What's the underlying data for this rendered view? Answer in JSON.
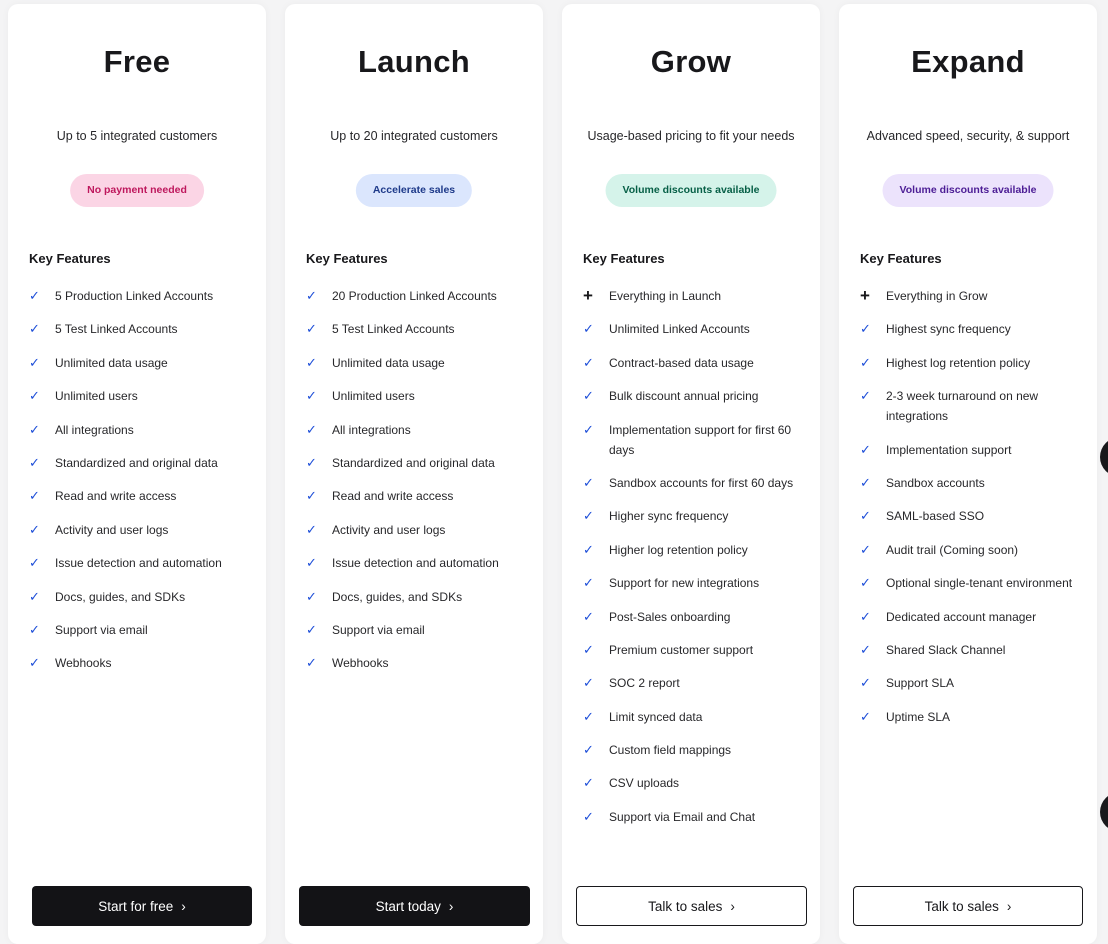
{
  "plans": [
    {
      "title": "Free",
      "subtitle": "Up to 5 integrated customers",
      "badge": "No payment needed",
      "badge_bg": "#fbd5e5",
      "badge_color": "#be185d",
      "key_features": "Key Features",
      "button": "Start for free",
      "button_style": "dark",
      "features": [
        {
          "icon": "check",
          "text": "5 Production Linked Accounts"
        },
        {
          "icon": "check",
          "text": "5 Test Linked Accounts"
        },
        {
          "icon": "check",
          "text": "Unlimited data usage"
        },
        {
          "icon": "check",
          "text": "Unlimited users"
        },
        {
          "icon": "check",
          "text": "All integrations"
        },
        {
          "icon": "check",
          "text": "Standardized and original data"
        },
        {
          "icon": "check",
          "text": "Read and write access"
        },
        {
          "icon": "check",
          "text": "Activity and user logs"
        },
        {
          "icon": "check",
          "text": "Issue detection and automation"
        },
        {
          "icon": "check",
          "text": "Docs, guides, and SDKs"
        },
        {
          "icon": "check",
          "text": "Support via email"
        },
        {
          "icon": "check",
          "text": "Webhooks"
        }
      ]
    },
    {
      "title": "Launch",
      "subtitle": "Up to 20 integrated customers",
      "badge": "Accelerate sales",
      "badge_bg": "#dbe6fd",
      "badge_color": "#1e3a8a",
      "key_features": "Key Features",
      "button": "Start today",
      "button_style": "dark",
      "features": [
        {
          "icon": "check",
          "text": "20 Production Linked Accounts"
        },
        {
          "icon": "check",
          "text": "5 Test Linked Accounts"
        },
        {
          "icon": "check",
          "text": "Unlimited data usage"
        },
        {
          "icon": "check",
          "text": "Unlimited users"
        },
        {
          "icon": "check",
          "text": "All integrations"
        },
        {
          "icon": "check",
          "text": "Standardized and original data"
        },
        {
          "icon": "check",
          "text": "Read and write access"
        },
        {
          "icon": "check",
          "text": "Activity and user logs"
        },
        {
          "icon": "check",
          "text": "Issue detection and automation"
        },
        {
          "icon": "check",
          "text": "Docs, guides, and SDKs"
        },
        {
          "icon": "check",
          "text": "Support via email"
        },
        {
          "icon": "check",
          "text": "Webhooks"
        }
      ]
    },
    {
      "title": "Grow",
      "subtitle": "Usage-based pricing to fit your needs",
      "badge": "Volume discounts available",
      "badge_bg": "#d5f3ea",
      "badge_color": "#065f46",
      "key_features": "Key Features",
      "button": "Talk to sales",
      "button_style": "light",
      "features": [
        {
          "icon": "plus",
          "text": "Everything in Launch"
        },
        {
          "icon": "check",
          "text": "Unlimited Linked Accounts"
        },
        {
          "icon": "check",
          "text": "Contract-based data usage"
        },
        {
          "icon": "check",
          "text": "Bulk discount annual pricing"
        },
        {
          "icon": "check",
          "text": "Implementation support for first 60 days"
        },
        {
          "icon": "check",
          "text": "Sandbox accounts for first 60 days"
        },
        {
          "icon": "check",
          "text": "Higher sync frequency"
        },
        {
          "icon": "check",
          "text": "Higher log retention policy"
        },
        {
          "icon": "check",
          "text": "Support for new integrations"
        },
        {
          "icon": "check",
          "text": "Post-Sales onboarding"
        },
        {
          "icon": "check",
          "text": "Premium customer support"
        },
        {
          "icon": "check",
          "text": "SOC 2 report"
        },
        {
          "icon": "check",
          "text": "Limit synced data"
        },
        {
          "icon": "check",
          "text": "Custom field mappings"
        },
        {
          "icon": "check",
          "text": "CSV uploads"
        },
        {
          "icon": "check",
          "text": "Support via Email and Chat"
        }
      ]
    },
    {
      "title": "Expand",
      "subtitle": "Advanced speed, security, & support",
      "badge": "Volume discounts available",
      "badge_bg": "#ece3fc",
      "badge_color": "#4c1d95",
      "key_features": "Key Features",
      "button": "Talk to sales",
      "button_style": "light",
      "features": [
        {
          "icon": "plus",
          "text": "Everything in Grow"
        },
        {
          "icon": "check",
          "text": "Highest sync frequency"
        },
        {
          "icon": "check",
          "text": "Highest log retention policy"
        },
        {
          "icon": "check",
          "text": "2-3 week turnaround on new integrations"
        },
        {
          "icon": "check",
          "text": "Implementation support"
        },
        {
          "icon": "check",
          "text": "Sandbox accounts"
        },
        {
          "icon": "check",
          "text": "SAML-based SSO"
        },
        {
          "icon": "check",
          "text": "Audit trail (Coming soon)"
        },
        {
          "icon": "check",
          "text": "Optional single-tenant environment"
        },
        {
          "icon": "check",
          "text": "Dedicated account manager"
        },
        {
          "icon": "check",
          "text": "Shared Slack Channel"
        },
        {
          "icon": "check",
          "text": "Support SLA"
        },
        {
          "icon": "check",
          "text": "Uptime SLA"
        }
      ]
    }
  ]
}
